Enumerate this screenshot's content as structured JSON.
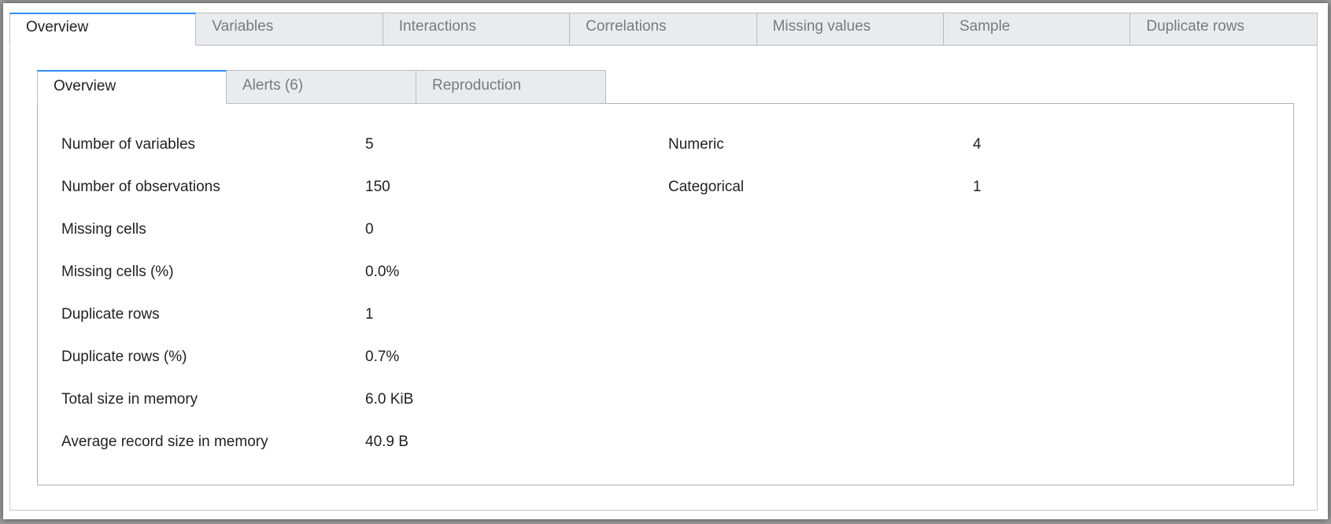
{
  "outer_tabs": [
    "Overview",
    "Variables",
    "Interactions",
    "Correlations",
    "Missing values",
    "Sample",
    "Duplicate rows"
  ],
  "inner_tabs": [
    "Overview",
    "Alerts (6)",
    "Reproduction"
  ],
  "dataset_statistics": [
    {
      "label": "Number of variables",
      "value": "5"
    },
    {
      "label": "Number of observations",
      "value": "150"
    },
    {
      "label": "Missing cells",
      "value": "0"
    },
    {
      "label": "Missing cells (%)",
      "value": "0.0%"
    },
    {
      "label": "Duplicate rows",
      "value": "1"
    },
    {
      "label": "Duplicate rows (%)",
      "value": "0.7%"
    },
    {
      "label": "Total size in memory",
      "value": "6.0 KiB"
    },
    {
      "label": "Average record size in memory",
      "value": "40.9 B"
    }
  ],
  "variable_types": [
    {
      "label": "Numeric",
      "value": "4"
    },
    {
      "label": "Categorical",
      "value": "1"
    }
  ]
}
